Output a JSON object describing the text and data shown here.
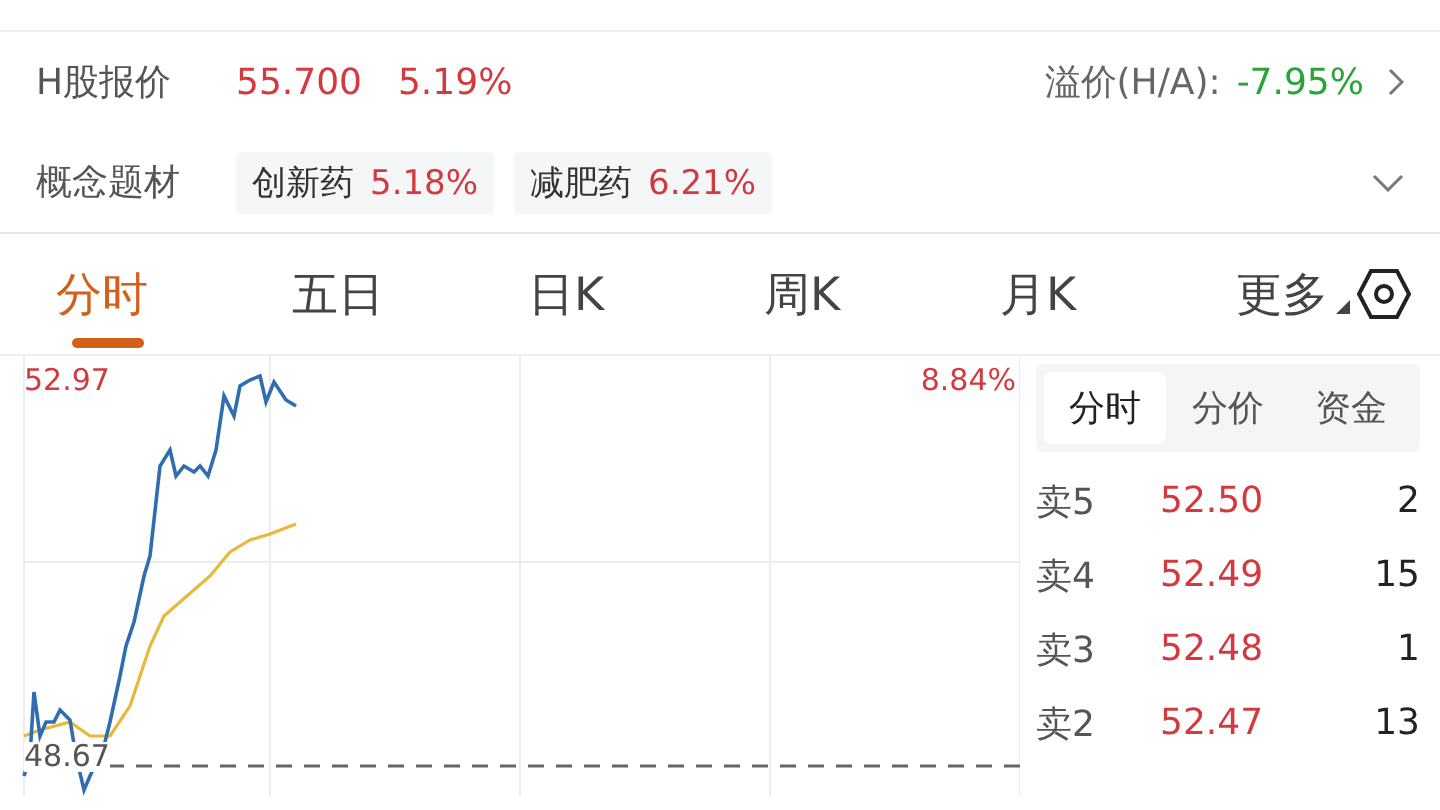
{
  "h_share": {
    "label": "H股报价",
    "price": "55.700",
    "change": "5.19%",
    "premium_label": "溢价(H/A):",
    "premium": "-7.95%"
  },
  "concepts": {
    "label": "概念题材",
    "tags": [
      {
        "name": "创新药",
        "change": "5.18%"
      },
      {
        "name": "减肥药",
        "change": "6.21%"
      }
    ]
  },
  "tabs": [
    {
      "label": "分时",
      "selected": true,
      "kind": "plain"
    },
    {
      "label": "五日",
      "selected": false,
      "kind": "plain"
    },
    {
      "label": "日K",
      "selected": false,
      "kind": "plain"
    },
    {
      "label": "周K",
      "selected": false,
      "kind": "plain"
    },
    {
      "label": "月K",
      "selected": false,
      "kind": "plain"
    },
    {
      "label": "更多",
      "selected": false,
      "kind": "dropdown"
    }
  ],
  "chart": {
    "high": "52.97",
    "high_pct": "8.84%",
    "base": "48.67"
  },
  "order_book": {
    "tabs": [
      {
        "label": "分时",
        "selected": true
      },
      {
        "label": "分价",
        "selected": false
      },
      {
        "label": "资金",
        "selected": false
      }
    ],
    "rows": [
      {
        "side": "卖5",
        "price": "52.50",
        "volume": "2"
      },
      {
        "side": "卖4",
        "price": "52.49",
        "volume": "15"
      },
      {
        "side": "卖3",
        "price": "52.48",
        "volume": "1"
      },
      {
        "side": "卖2",
        "price": "52.47",
        "volume": "13"
      }
    ]
  }
}
